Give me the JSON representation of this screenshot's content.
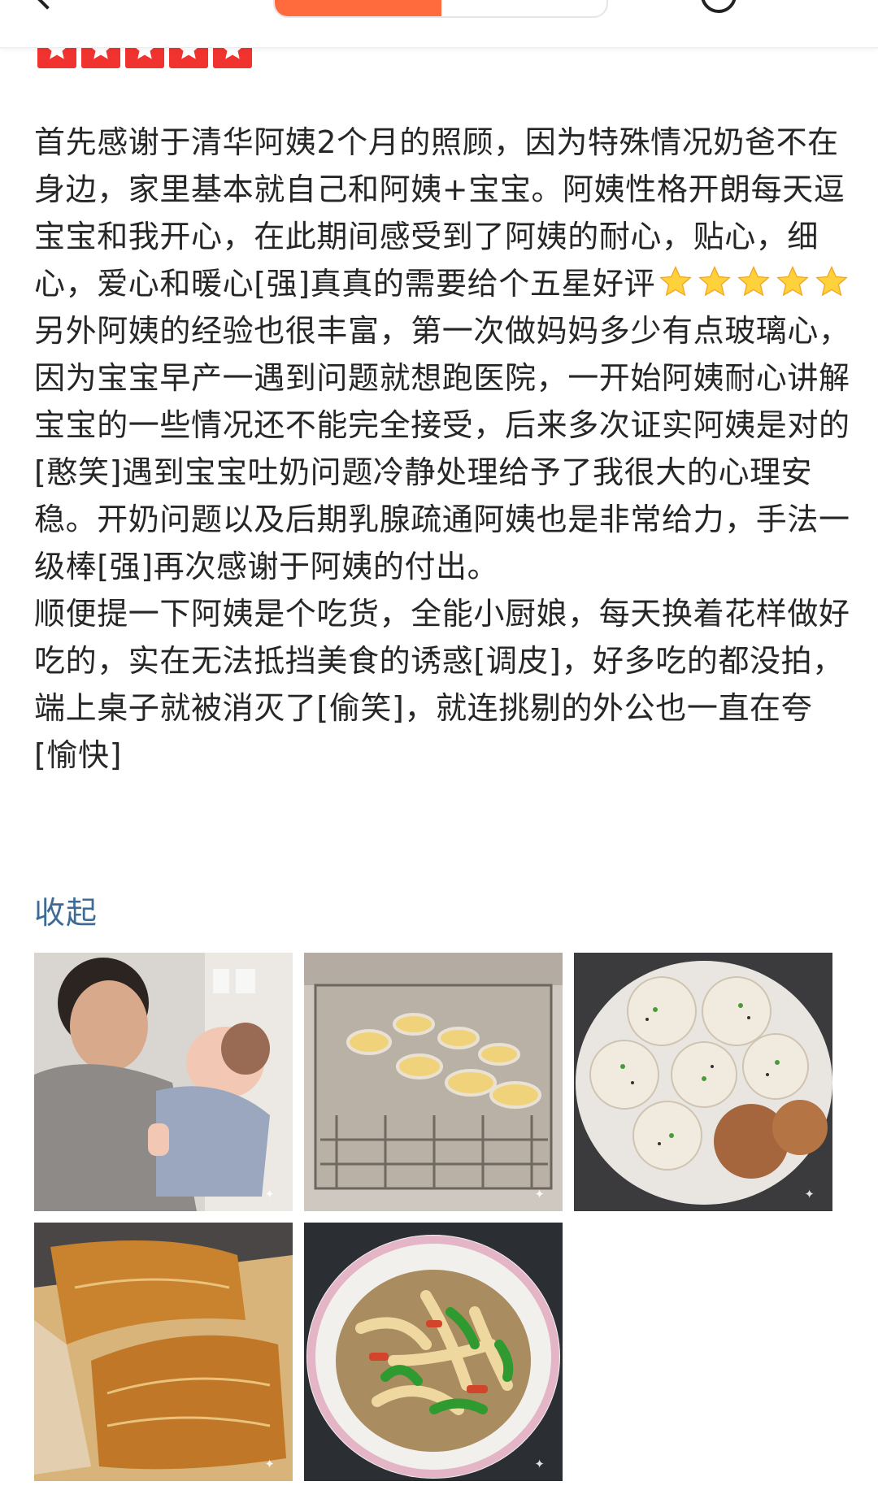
{
  "nav": {
    "tab_active_label": "",
    "tab_inactive_label": ""
  },
  "rating": {
    "stars": 5,
    "max": 5,
    "color": "#f0332e"
  },
  "review": {
    "paragraphs": [
      "首先感谢于清华阿姨2个月的照顾，因为特殊情况奶爸不在身边，家里基本就自己和阿姨+宝宝。阿姨性格开朗每天逗宝宝和我开心，在此期间感受到了阿姨的耐心，贴心，细心，爱心和暖心[强]真真的需要给个五星好评",
      "另外阿姨的经验也很丰富，第一次做妈妈多少有点玻璃心，因为宝宝早产一遇到问题就想跑医院，一开始阿姨耐心讲解宝宝的一些情况还不能完全接受，后来多次证实阿姨是对的[憨笑]遇到宝宝吐奶问题冷静处理给予了我很大的心理安稳。开奶问题以及后期乳腺疏通阿姨也是非常给力，手法一级棒[强]再次感谢于阿姨的付出。",
      "顺便提一下阿姨是个吃货，全能小厨娘，每天换着花样做好吃的，实在无法抵挡美食的诱惑[调皮]，好多吃的都没拍，端上桌子就被消灭了[偷笑]，就连挑剔的外公也一直在夸[愉快]"
    ],
    "emoji_star_count": 5,
    "collapse_label": "收起"
  },
  "photos": [
    {
      "name": "photo-nanny-with-baby"
    },
    {
      "name": "photo-egg-tarts-oven"
    },
    {
      "name": "photo-pan-fried-buns"
    },
    {
      "name": "photo-baked-bread"
    },
    {
      "name": "photo-stir-fry-dish"
    }
  ],
  "colors": {
    "accent": "#ff6b3d",
    "link": "#3d6b96",
    "text": "#262626"
  }
}
